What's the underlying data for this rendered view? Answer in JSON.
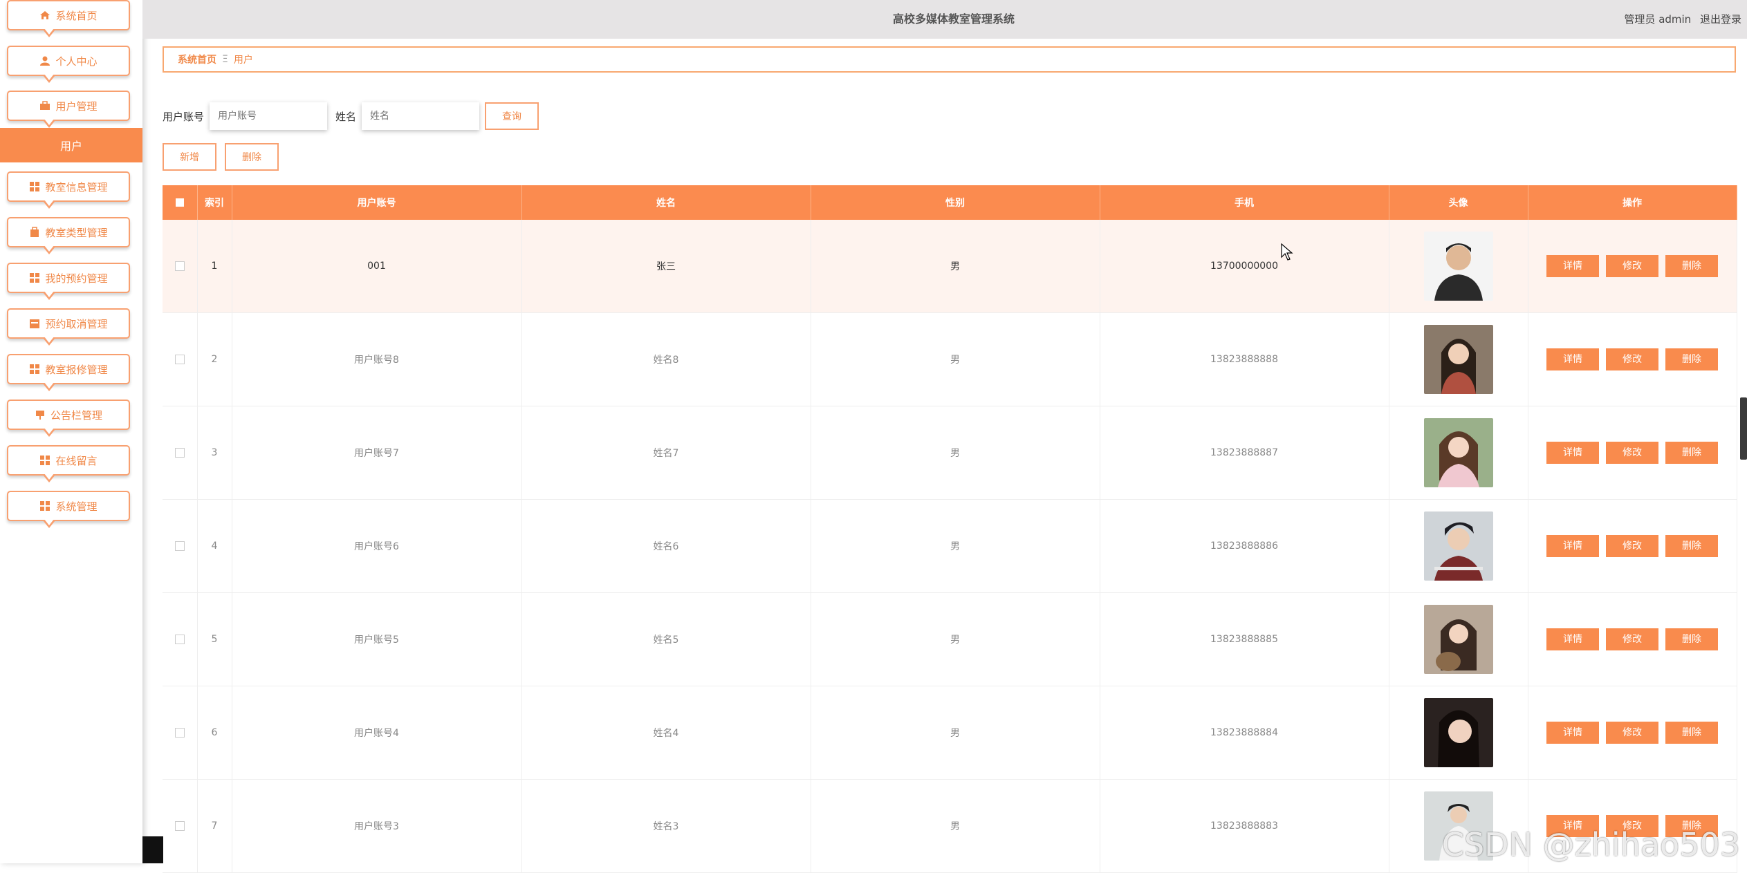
{
  "header": {
    "title": "高校多媒体教室管理系统",
    "user_label": "管理员 admin",
    "logout": "退出登录"
  },
  "sidebar": {
    "items": [
      {
        "label": "系统首页",
        "icon": "home-icon"
      },
      {
        "label": "个人中心",
        "icon": "user-icon"
      },
      {
        "label": "用户管理",
        "icon": "briefcase-icon"
      },
      {
        "label": "教室信息管理",
        "icon": "grid-icon"
      },
      {
        "label": "教室类型管理",
        "icon": "bag-icon"
      },
      {
        "label": "我的预约管理",
        "icon": "grid-icon"
      },
      {
        "label": "预约取消管理",
        "icon": "calendar-icon"
      },
      {
        "label": "教室报修管理",
        "icon": "grid-icon"
      },
      {
        "label": "公告栏管理",
        "icon": "board-icon"
      },
      {
        "label": "在线留言",
        "icon": "grid-icon"
      },
      {
        "label": "系统管理",
        "icon": "grid-icon"
      }
    ],
    "active_submenu": "用户"
  },
  "breadcrumb": {
    "home": "系统首页",
    "separator": "Ξ",
    "current": "用户"
  },
  "search": {
    "account_label": "用户账号",
    "account_placeholder": "用户账号",
    "name_label": "姓名",
    "name_placeholder": "姓名",
    "query_button": "查询"
  },
  "actions": {
    "add": "新增",
    "delete": "删除"
  },
  "table": {
    "columns": [
      "索引",
      "用户账号",
      "姓名",
      "性别",
      "手机",
      "头像",
      "操作"
    ],
    "rows": [
      {
        "index": "1",
        "account": "001",
        "name": "张三",
        "gender": "男",
        "phone": "13700000000"
      },
      {
        "index": "2",
        "account": "用户账号8",
        "name": "姓名8",
        "gender": "男",
        "phone": "13823888888"
      },
      {
        "index": "3",
        "account": "用户账号7",
        "name": "姓名7",
        "gender": "男",
        "phone": "13823888887"
      },
      {
        "index": "4",
        "account": "用户账号6",
        "name": "姓名6",
        "gender": "男",
        "phone": "13823888886"
      },
      {
        "index": "5",
        "account": "用户账号5",
        "name": "姓名5",
        "gender": "男",
        "phone": "13823888885"
      },
      {
        "index": "6",
        "account": "用户账号4",
        "name": "姓名4",
        "gender": "男",
        "phone": "13823888884"
      },
      {
        "index": "7",
        "account": "用户账号3",
        "name": "姓名3",
        "gender": "男",
        "phone": "13823888883"
      }
    ],
    "op_detail": "详情",
    "op_edit": "修改",
    "op_delete": "删除"
  },
  "watermark": "CSDN @zhihao503",
  "colors": {
    "accent": "#f98b4d",
    "border": "#f8a070",
    "header_bg": "#e6e4e5"
  }
}
